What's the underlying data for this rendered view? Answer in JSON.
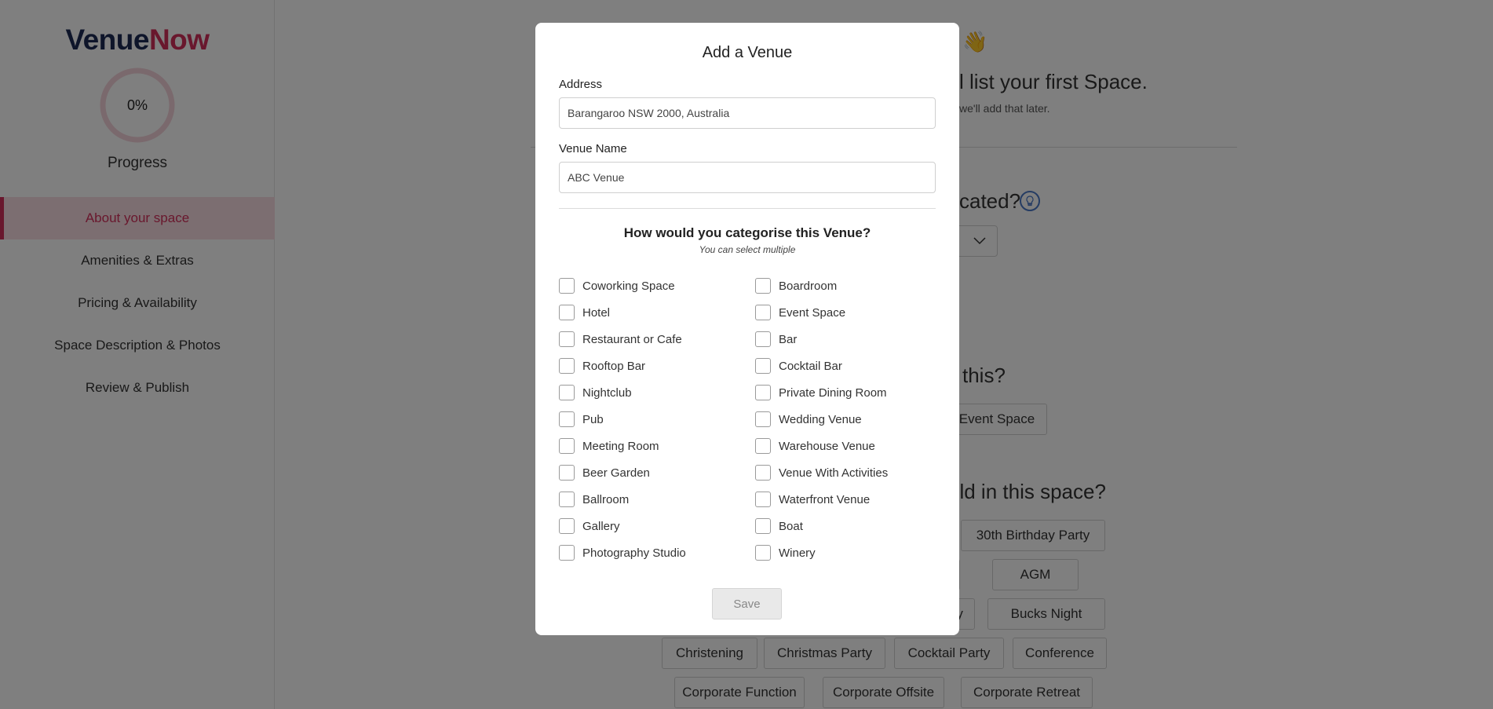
{
  "brand": {
    "part1": "Venue",
    "part2": "Now",
    "color_primary": "#1c2a55",
    "color_accent": "#d32f5a"
  },
  "progress": {
    "value": 0,
    "text": "0%",
    "label": "Progress"
  },
  "nav": {
    "items": [
      {
        "label": "About your space",
        "active": true
      },
      {
        "label": "Amenities & Extras",
        "active": false
      },
      {
        "label": "Pricing & Availability",
        "active": false
      },
      {
        "label": "Space Description & Photos",
        "active": false
      },
      {
        "label": "Review & Publish",
        "active": false
      }
    ]
  },
  "background": {
    "emoji": "👋",
    "heading": "l list your first Space.",
    "subheading": "we'll add that later.",
    "location_question": "cated?",
    "type_question": "this?",
    "selected_type_chip": "Event Space",
    "events_question": "old in this space?",
    "event_chips": [
      "30th Birthday Party",
      "ty",
      "AGM",
      "Party",
      "Bucks Night",
      "Christening",
      "Christmas Party",
      "Cocktail Party",
      "Conference",
      "Corporate Function",
      "Corporate Offsite",
      "Corporate Retreat"
    ]
  },
  "modal": {
    "title": "Add a Venue",
    "address_label": "Address",
    "address_value": "Barangaroo NSW 2000, Australia",
    "venue_name_label": "Venue Name",
    "venue_name_value": "ABC Venue",
    "category_title": "How would you categorise this Venue?",
    "category_subtitle": "You can select multiple",
    "categories_left": [
      "Coworking Space",
      "Hotel",
      "Restaurant or Cafe",
      "Rooftop Bar",
      "Nightclub",
      "Pub",
      "Meeting Room",
      "Beer Garden",
      "Ballroom",
      "Gallery",
      "Photography Studio"
    ],
    "categories_right": [
      "Boardroom",
      "Event Space",
      "Bar",
      "Cocktail Bar",
      "Private Dining Room",
      "Wedding Venue",
      "Warehouse Venue",
      "Venue With Activities",
      "Waterfront Venue",
      "Boat",
      "Winery"
    ],
    "save_label": "Save"
  }
}
